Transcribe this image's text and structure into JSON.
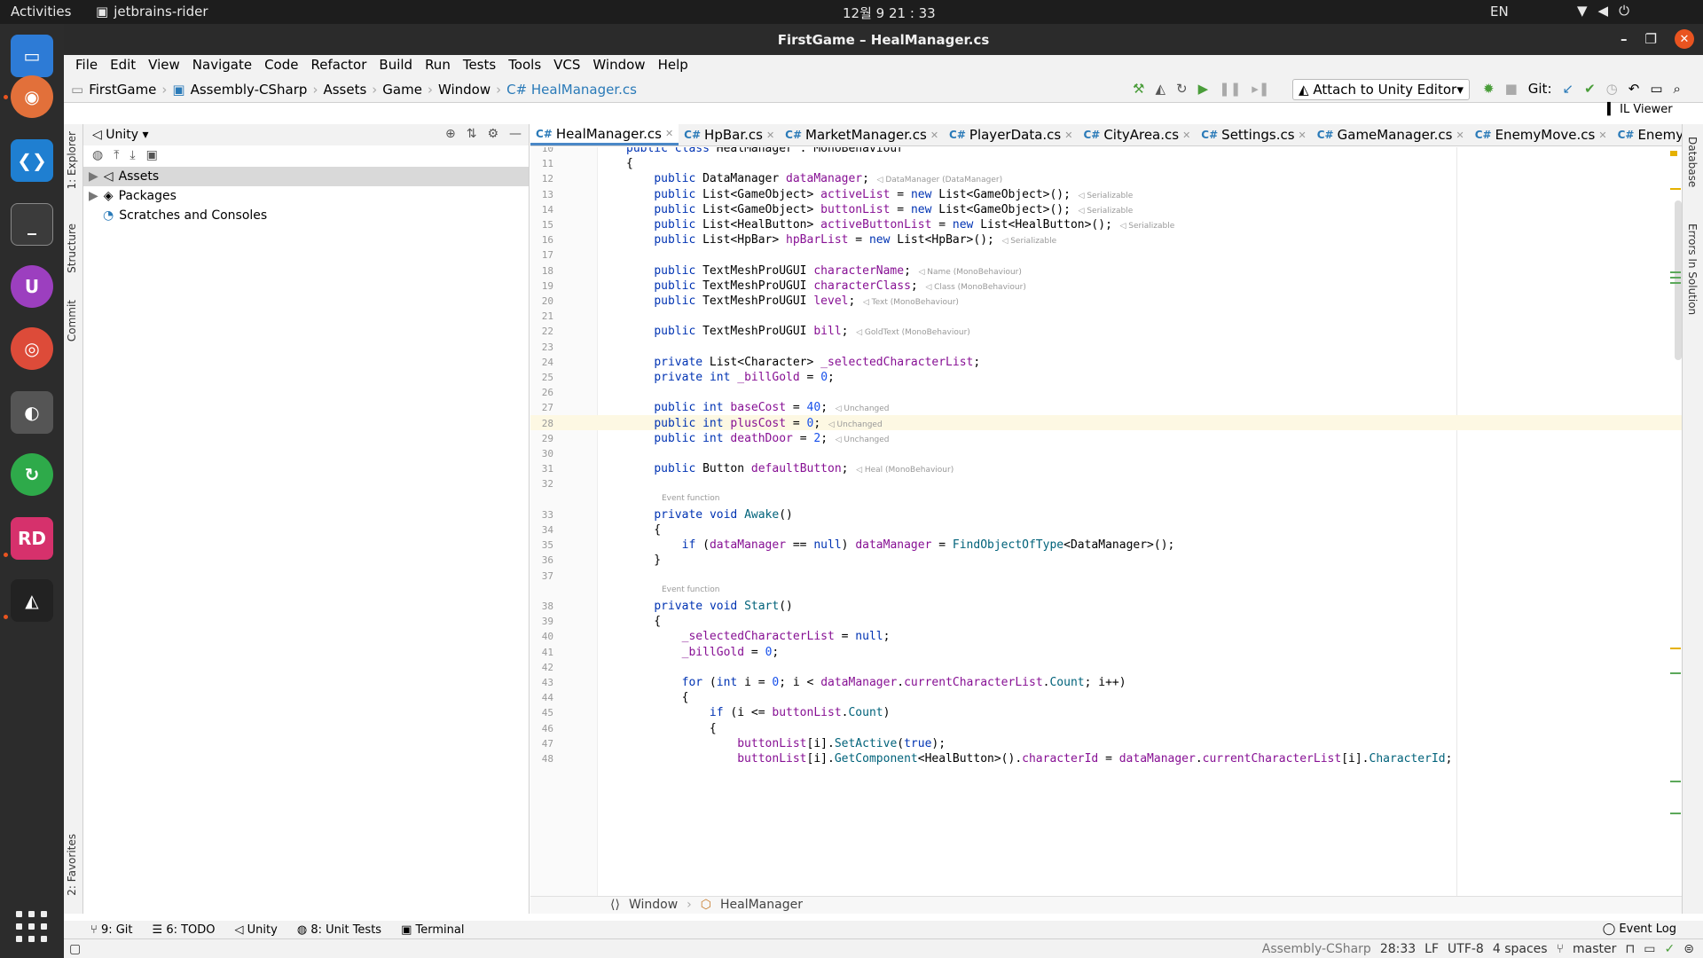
{
  "topbar": {
    "activities": "Activities",
    "app_name": "jetbrains-rider",
    "clock": "12월 9  21 : 33",
    "lang": "EN"
  },
  "window": {
    "title": "FirstGame – HealManager.cs"
  },
  "menu": [
    "File",
    "Edit",
    "View",
    "Navigate",
    "Code",
    "Refactor",
    "Build",
    "Run",
    "Tests",
    "Tools",
    "VCS",
    "Window",
    "Help"
  ],
  "breadcrumb": [
    "FirstGame",
    "Assembly-CSharp",
    "Assets",
    "Game",
    "Window",
    "C# HealManager.cs"
  ],
  "toolbar": {
    "attach": "Attach to Unity Editor",
    "git_label": "Git:",
    "il_viewer": "IL Viewer"
  },
  "left_tabs": [
    "1: Explorer",
    "Structure",
    "Commit",
    "2: Favorites"
  ],
  "right_tabs": [
    "Database",
    "Errors In Solution"
  ],
  "explorer": {
    "dropdown": "Unity",
    "items": [
      "Assets",
      "Packages",
      "Scratches and Consoles"
    ]
  },
  "tabs": [
    "HealManager.cs",
    "HpBar.cs",
    "MarketManager.cs",
    "PlayerData.cs",
    "CityArea.cs",
    "Settings.cs",
    "GameManager.cs",
    "EnemyMove.cs",
    "EnemyAi.cs"
  ],
  "code_lines": [
    {
      "n": "10",
      "t": "public class HealManager : MonoBehaviour"
    },
    {
      "n": "11",
      "t": "{"
    },
    {
      "n": "12",
      "t": "    public DataManager dataManager;",
      "h": "DataManager (DataManager)"
    },
    {
      "n": "13",
      "t": "    public List<GameObject> activeList = new List<GameObject>();",
      "h": "Serializable"
    },
    {
      "n": "14",
      "t": "    public List<GameObject> buttonList = new List<GameObject>();",
      "h": "Serializable"
    },
    {
      "n": "15",
      "t": "    public List<HealButton> activeButtonList = new List<HealButton>();",
      "h": "Serializable"
    },
    {
      "n": "16",
      "t": "    public List<HpBar> hpBarList = new List<HpBar>();",
      "h": "Serializable"
    },
    {
      "n": "17",
      "t": ""
    },
    {
      "n": "18",
      "t": "    public TextMeshProUGUI characterName;",
      "h": "Name (MonoBehaviour)"
    },
    {
      "n": "19",
      "t": "    public TextMeshProUGUI characterClass;",
      "h": "Class (MonoBehaviour)"
    },
    {
      "n": "20",
      "t": "    public TextMeshProUGUI level;",
      "h": "Text (MonoBehaviour)"
    },
    {
      "n": "21",
      "t": ""
    },
    {
      "n": "22",
      "t": "    public TextMeshProUGUI bill;",
      "h": "GoldText (MonoBehaviour)"
    },
    {
      "n": "23",
      "t": ""
    },
    {
      "n": "24",
      "t": "    private List<Character> _selectedCharacterList;"
    },
    {
      "n": "25",
      "t": "    private int _billGold = 0;"
    },
    {
      "n": "26",
      "t": ""
    },
    {
      "n": "27",
      "t": "    public int baseCost = 40;",
      "h": "Unchanged"
    },
    {
      "n": "28",
      "t": "    public int plusCost = 0;",
      "h": "Unchanged"
    },
    {
      "n": "29",
      "t": "    public int deathDoor = 2;",
      "h": "Unchanged"
    },
    {
      "n": "30",
      "t": ""
    },
    {
      "n": "31",
      "t": "    public Button defaultButton;",
      "h": "Heal (MonoBehaviour)"
    },
    {
      "n": "32",
      "t": ""
    },
    {
      "n": "",
      "t": "",
      "a": "Event function"
    },
    {
      "n": "33",
      "t": "    private void Awake()"
    },
    {
      "n": "34",
      "t": "    {"
    },
    {
      "n": "35",
      "t": "        if (dataManager == null) dataManager = FindObjectOfType<DataManager>();"
    },
    {
      "n": "36",
      "t": "    }"
    },
    {
      "n": "37",
      "t": ""
    },
    {
      "n": "",
      "t": "",
      "a": "Event function"
    },
    {
      "n": "38",
      "t": "    private void Start()"
    },
    {
      "n": "39",
      "t": "    {"
    },
    {
      "n": "40",
      "t": "        _selectedCharacterList = null;"
    },
    {
      "n": "41",
      "t": "        _billGold = 0;"
    },
    {
      "n": "42",
      "t": ""
    },
    {
      "n": "43",
      "t": "        for (int i = 0; i < dataManager.currentCharacterList.Count; i++)"
    },
    {
      "n": "44",
      "t": "        {"
    },
    {
      "n": "45",
      "t": "            if (i <= buttonList.Count)"
    },
    {
      "n": "46",
      "t": "            {"
    },
    {
      "n": "47",
      "t": "                buttonList[i].SetActive(true);"
    },
    {
      "n": "48",
      "t": "                buttonList[i].GetComponent<HealButton>().characterId = dataManager.currentCharacterList[i].CharacterId;"
    }
  ],
  "editor_footer": [
    "Window",
    "HealManager"
  ],
  "bottom_tabs": [
    "9: Git",
    "6: TODO",
    "Unity",
    "8: Unit Tests",
    "Terminal"
  ],
  "event_log": "Event Log",
  "status": {
    "project": "Assembly-CSharp",
    "position": "28:33",
    "line_sep": "LF",
    "encoding": "UTF-8",
    "indent": "4 spaces",
    "branch": "master"
  }
}
